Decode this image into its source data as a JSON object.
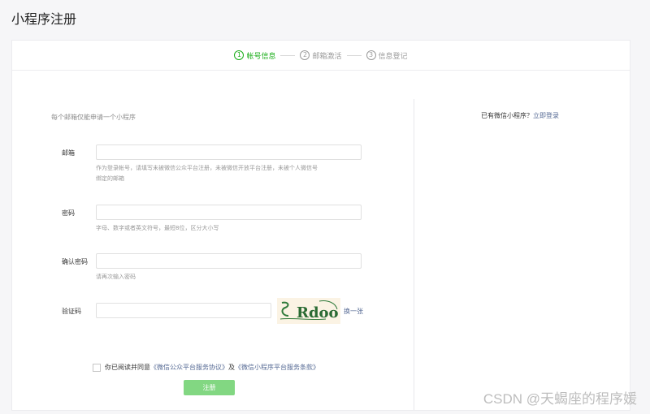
{
  "page": {
    "title": "小程序注册"
  },
  "steps": [
    {
      "num": "1",
      "label": "帐号信息"
    },
    {
      "num": "2",
      "label": "邮箱激活"
    },
    {
      "num": "3",
      "label": "信息登记"
    }
  ],
  "form": {
    "tip": "每个邮箱仅能申请一个小程序",
    "email": {
      "label": "邮箱",
      "value": "",
      "hint_line1": "作为登录帐号，请填写未被微信公众平台注册，未被微信开放平台注册，未被个人微信号",
      "hint_line2": "绑定的邮箱"
    },
    "password": {
      "label": "密码",
      "value": "",
      "hint": "字母、数字或者英文符号，最短8位，区分大小写"
    },
    "confirm": {
      "label": "确认密码",
      "value": "",
      "hint": "请再次输入密码"
    },
    "captcha": {
      "label": "验证码",
      "value": "",
      "image_text": "Rdoo",
      "refresh": "换一张"
    },
    "agree": {
      "prefix": "你已阅读并同意",
      "link1": "《微信公众平台服务协议》",
      "middle": "及",
      "link2": "《微信小程序平台服务条款》"
    },
    "submit": "注册"
  },
  "aside": {
    "prefix": "已有微信小程序？",
    "login_link": "立即登录"
  },
  "watermark": "CSDN @天蝎座的程序媛",
  "colors": {
    "accent": "#1aad19",
    "link": "#576b95",
    "button": "#82d782"
  }
}
